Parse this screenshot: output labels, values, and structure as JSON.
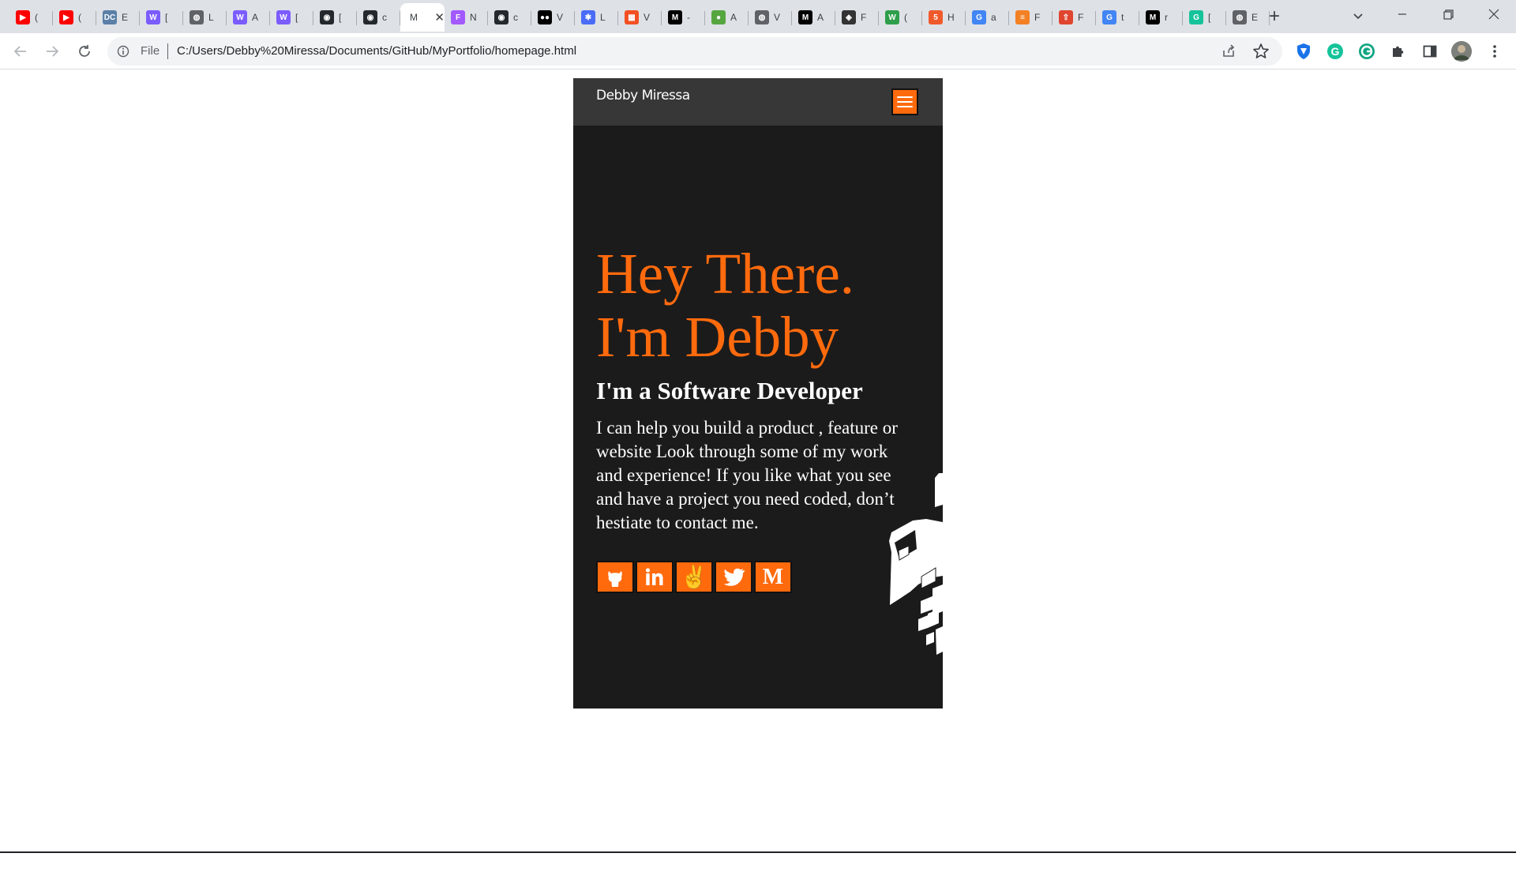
{
  "browser": {
    "tabs": [
      {
        "icon": "youtube-icon",
        "color": "#ff0000",
        "glyph": "▶",
        "title": "("
      },
      {
        "icon": "youtube-icon",
        "color": "#ff0000",
        "glyph": "▶",
        "title": "("
      },
      {
        "icon": "dc-icon",
        "color": "#5b7fa6",
        "glyph": "DC",
        "title": "E"
      },
      {
        "icon": "wix-icon",
        "color": "#7b5cff",
        "glyph": "W",
        "title": "["
      },
      {
        "icon": "globe-icon",
        "color": "#5f6368",
        "glyph": "◍",
        "title": "L"
      },
      {
        "icon": "wix-icon",
        "color": "#7b5cff",
        "glyph": "W",
        "title": "A"
      },
      {
        "icon": "wix-icon",
        "color": "#7b5cff",
        "glyph": "W",
        "title": "["
      },
      {
        "icon": "github-icon",
        "color": "#24292e",
        "glyph": "◉",
        "title": "["
      },
      {
        "icon": "github-icon",
        "color": "#24292e",
        "glyph": "◉",
        "title": "c"
      },
      {
        "icon": "file-icon",
        "color": "#ffffff",
        "glyph": "M",
        "title": "",
        "active": true
      },
      {
        "icon": "figma-icon",
        "color": "#a259ff",
        "glyph": "F",
        "title": "N"
      },
      {
        "icon": "github-icon",
        "color": "#24292e",
        "glyph": "◉",
        "title": "c"
      },
      {
        "icon": "medium-icon",
        "color": "#000000",
        "glyph": "●●",
        "title": "V"
      },
      {
        "icon": "snowflake-icon",
        "color": "#4a6cf7",
        "glyph": "✱",
        "title": "L"
      },
      {
        "icon": "microsoft-icon",
        "color": "#f25022",
        "glyph": "▦",
        "title": "V"
      },
      {
        "icon": "m-icon",
        "color": "#000000",
        "glyph": "M",
        "title": "-"
      },
      {
        "icon": "leaf-icon",
        "color": "#56a640",
        "glyph": "●",
        "title": "A"
      },
      {
        "icon": "globe-icon",
        "color": "#5f6368",
        "glyph": "◍",
        "title": "V"
      },
      {
        "icon": "m-icon",
        "color": "#000000",
        "glyph": "M",
        "title": "A"
      },
      {
        "icon": "codepen-icon",
        "color": "#333333",
        "glyph": "◈",
        "title": "F"
      },
      {
        "icon": "w-icon",
        "color": "#2e9e4a",
        "glyph": "W",
        "title": "("
      },
      {
        "icon": "html5-icon",
        "color": "#f05a2b",
        "glyph": "5",
        "title": "H"
      },
      {
        "icon": "google-icon",
        "color": "#4285f4",
        "glyph": "G",
        "title": "a"
      },
      {
        "icon": "stackoverflow-icon",
        "color": "#f48024",
        "glyph": "≡",
        "title": "F"
      },
      {
        "icon": "bookmark-icon",
        "color": "#e0452f",
        "glyph": "⇧",
        "title": "F"
      },
      {
        "icon": "google-icon",
        "color": "#4285f4",
        "glyph": "G",
        "title": "t"
      },
      {
        "icon": "m-icon",
        "color": "#000000",
        "glyph": "M",
        "title": "r"
      },
      {
        "icon": "grammarly-icon",
        "color": "#15c39a",
        "glyph": "G",
        "title": "["
      },
      {
        "icon": "globe-icon",
        "color": "#5f6368",
        "glyph": "◍",
        "title": "E"
      }
    ],
    "address": {
      "file_label": "File",
      "url": "C:/Users/Debby%20Miressa/Documents/GitHub/MyPortfolio/homepage.html"
    }
  },
  "site": {
    "brand": "Debby Miressa",
    "hero_line1": "Hey There.",
    "hero_line2": "I'm Debby",
    "subtitle": "I'm a Software Developer",
    "body": "I can help you build a product , feature or website Look through some of my work and experience! If you like what you see and have a project you need coded, don’t hestiate to contact me.",
    "socials": [
      {
        "name": "github",
        "glyph": ""
      },
      {
        "name": "linkedin",
        "glyph": "in"
      },
      {
        "name": "angellist",
        "glyph": "✌"
      },
      {
        "name": "twitter",
        "glyph": ""
      },
      {
        "name": "medium",
        "glyph": "M"
      }
    ],
    "colors": {
      "accent": "#ff6a0d",
      "background": "#1c1b1b",
      "navbar": "#383737"
    }
  }
}
